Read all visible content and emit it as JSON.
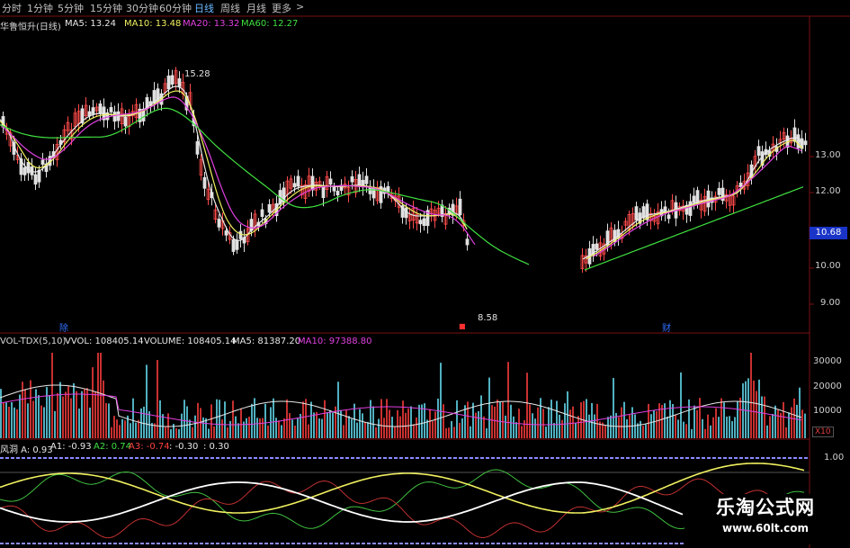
{
  "tabs": [
    "分时",
    "1分钟",
    "5分钟",
    "15分钟",
    "30分钟",
    "60分钟",
    "日线",
    "周线",
    "月线",
    "更多"
  ],
  "active_tab": "日线",
  "more_arrow": ">",
  "price_panel": {
    "legend": [
      {
        "text": "华鲁恒升(日线)",
        "color": "#d8d8d8"
      },
      {
        "text": "MA5: 13.24",
        "color": "#e8e8e8"
      },
      {
        "text": "MA10: 13.48",
        "color": "#f0f060"
      },
      {
        "text": "MA20: 13.32",
        "color": "#e040e0"
      },
      {
        "text": "MA60: 12.27",
        "color": "#40e040"
      }
    ],
    "y_ticks": [
      "13.00",
      "12.00",
      "11.00",
      "10.00",
      "9.00"
    ],
    "current_price": "10.68",
    "high_label": "15.28",
    "low_label": "8.58",
    "markers": [
      {
        "text": "除",
        "color": "#3070ff"
      },
      {
        "text": "■",
        "color": "#ff3030"
      },
      {
        "text": "财",
        "color": "#3070ff"
      }
    ]
  },
  "volume_panel": {
    "legend": [
      {
        "text": "VOL-TDX(5,10)",
        "color": "#d8d8d8"
      },
      {
        "text": "VVOL: 108405.14",
        "color": "#e8e8e8"
      },
      {
        "text": "VOLUME: 108405.14",
        "color": "#e8e8e8"
      },
      {
        "text": "MA5: 81387.20",
        "color": "#e8e8e8"
      },
      {
        "text": "MA10: 97388.80",
        "color": "#e040e0"
      }
    ],
    "y_ticks": [
      "30000",
      "20000",
      "10000"
    ],
    "unit": "X10"
  },
  "indicator_panel": {
    "legend": [
      {
        "text": "风洞 A: 0.93",
        "color": "#e8e8e8"
      },
      {
        "text": "A1: -0.93",
        "color": "#e8e8e8"
      },
      {
        "text": "A2: 0.74",
        "color": "#40e040"
      },
      {
        "text": "A3: -0.74",
        "color": "#ff4040"
      },
      {
        "text": ": -0.30",
        "color": "#e8e8e8"
      },
      {
        "text": ": 0.30",
        "color": "#e8e8e8"
      }
    ],
    "y_ticks": [
      "1.00"
    ]
  },
  "watermark": {
    "title": "乐淘公式网",
    "url": "www.60lt.com"
  }
}
